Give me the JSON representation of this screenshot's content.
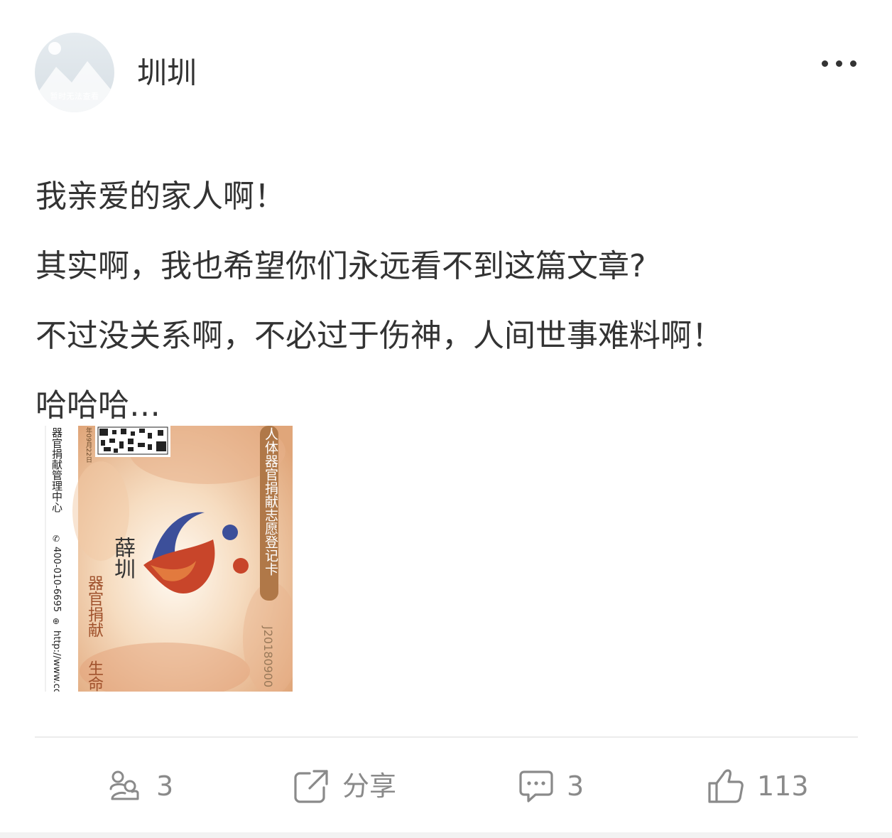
{
  "post": {
    "author": {
      "name": "圳圳",
      "avatar_placeholder_text": "暂时无法查看"
    },
    "menu_icon": "more-dots-icon",
    "lines": [
      "我亲爱的家人啊！",
      "其实啊，我也希望你们永远看不到这篇文章?",
      "不过没关系啊，不必过于伤神，人间世事难料啊！",
      "哈哈哈…"
    ],
    "image": {
      "card_title": "人体器官捐献志愿登记卡",
      "holder_name": "薛圳",
      "slogan": "器官捐献",
      "slogan_extra": "生命",
      "org_name": "器官捐献管理中心",
      "phone": "400-010-6695",
      "website": "http://www.co",
      "card_number": "J20180900",
      "date_text": "年09月22日"
    }
  },
  "actions": {
    "repost": {
      "icon": "repost-icon",
      "count": "3"
    },
    "share": {
      "icon": "share-icon",
      "label": "分享"
    },
    "comment": {
      "icon": "comment-icon",
      "count": "3"
    },
    "like": {
      "icon": "thumbs-up-icon",
      "count": "113"
    }
  },
  "colors": {
    "text": "#333333",
    "muted": "#8a8a8a",
    "card_brown": "#b07848",
    "logo_blue": "#3c4f9a",
    "logo_red": "#c8452a"
  }
}
